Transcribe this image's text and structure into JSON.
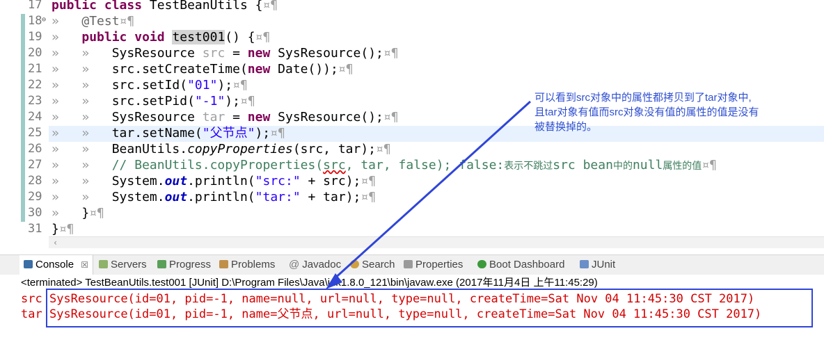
{
  "editor": {
    "line_numbers": [
      "17",
      "18",
      "19",
      "20",
      "21",
      "22",
      "23",
      "24",
      "25",
      "26",
      "27",
      "28",
      "29",
      "30",
      "31"
    ],
    "lines": {
      "l17_kw1": "public",
      "l17_kw2": "class",
      "l17_rest": " TestBeanUtils {",
      "l18_ann": "@Test",
      "l19_kw1": "public",
      "l19_kw2": "void",
      "l19_method": "test001",
      "l19_rest": "() {",
      "l20_a": "SysResource ",
      "l20_var": "src",
      "l20_b": " = ",
      "l20_kw": "new",
      "l20_c": " SysResource();",
      "l21_a": "src.setCreateTime(",
      "l21_kw": "new",
      "l21_b": " Date());",
      "l22_a": "src.setId(",
      "l22_str": "\"01\"",
      "l22_b": ");",
      "l23_a": "src.setPid(",
      "l23_str": "\"-1\"",
      "l23_b": ");",
      "l24_a": "SysResource ",
      "l24_var": "tar",
      "l24_b": " = ",
      "l24_kw": "new",
      "l24_c": " SysResource();",
      "l25_a": "tar.setName(",
      "l25_str": "\"父节点\"",
      "l25_b": ");",
      "l26_a": "BeanUtils.",
      "l26_m": "copyProperties",
      "l26_b": "(src, tar);",
      "l27_a": "// BeanUtils.copyProperties(",
      "l27_src": "src",
      "l27_b": ", tar, false); false:",
      "l27_cn1": "表示不跳过",
      "l27_c": "src bean",
      "l27_cn2": "中的",
      "l27_d": "null",
      "l27_cn3": "属性的值",
      "l28_a": "System.",
      "l28_f": "out",
      "l28_b": ".println(",
      "l28_str": "\"src:\"",
      "l28_c": " + src);",
      "l29_a": "System.",
      "l29_f": "out",
      "l29_b": ".println(",
      "l29_str": "\"tar:\"",
      "l29_c": " + tar);",
      "l30": "}",
      "l31": "}"
    },
    "pilcrow": "¤¶",
    "tab_mark": "»"
  },
  "annotation": {
    "line1": "可以看到src对象中的属性都拷贝到了tar对象中,",
    "line2": "且tar对象有值而src对象没有值的属性的值是没有",
    "line3": "被替换掉的。"
  },
  "tabs": [
    {
      "label": "Console",
      "icon": "console-icon"
    },
    {
      "label": "Servers",
      "icon": "servers-icon"
    },
    {
      "label": "Progress",
      "icon": "progress-icon"
    },
    {
      "label": "Problems",
      "icon": "problems-icon"
    },
    {
      "label": "Javadoc",
      "icon": "javadoc-icon"
    },
    {
      "label": "Search",
      "icon": "search-icon"
    },
    {
      "label": "Properties",
      "icon": "properties-icon"
    },
    {
      "label": "Boot Dashboard",
      "icon": "boot-dashboard-icon"
    },
    {
      "label": "JUnit",
      "icon": "junit-icon"
    }
  ],
  "console": {
    "close_glyph": "☒",
    "terminated": "<terminated> TestBeanUtils.test001 [JUnit] D:\\Program Files\\Java\\jdk1.8.0_121\\bin\\javaw.exe (2017年11月4日 上午11:45:29)",
    "out1_label": "src",
    "out1_value": "SysResource(id=01, pid=-1, name=null, url=null, type=null, createTime=Sat Nov 04 11:45:30 CST 2017)",
    "out2_label": "tar",
    "out2_value": "SysResource(id=01, pid=-1, name=父节点, url=null, type=null, createTime=Sat Nov 04 11:45:30 CST 2017)"
  },
  "colors": {
    "keyword": "#7f0055",
    "string": "#2a00ff",
    "comment": "#3f7f5f",
    "console_error": "#d40000",
    "annotation_blue": "#2f45d8"
  }
}
